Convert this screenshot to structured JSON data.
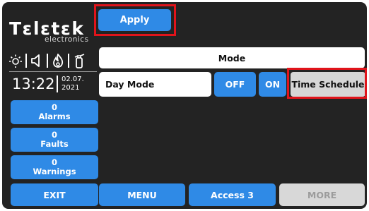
{
  "brand": {
    "name": "TELETEK",
    "tagline": "electronics"
  },
  "status_icons": [
    "sun-icon",
    "speaker-icon",
    "flame-icon",
    "fire-extinguisher-icon"
  ],
  "clock": {
    "time": "13:22",
    "date_line1": "02.07.",
    "date_line2": "2021"
  },
  "counters": [
    {
      "count": "0",
      "label": "Alarms"
    },
    {
      "count": "0",
      "label": "Faults"
    },
    {
      "count": "0",
      "label": "Warnings"
    }
  ],
  "toolbar": {
    "apply_label": "Apply"
  },
  "mode": {
    "header": "Mode",
    "current_value": "Day Mode",
    "off_label": "OFF",
    "on_label": "ON",
    "schedule_label": "Time Schedule"
  },
  "footer": {
    "exit_label": "EXIT",
    "menu_label": "MENU",
    "access_label": "Access 3",
    "more_label": "MORE"
  },
  "colors": {
    "background": "#232323",
    "accent": "#2f8ae6",
    "highlight": "#e0141b",
    "disabled": "#d8d8d8"
  }
}
